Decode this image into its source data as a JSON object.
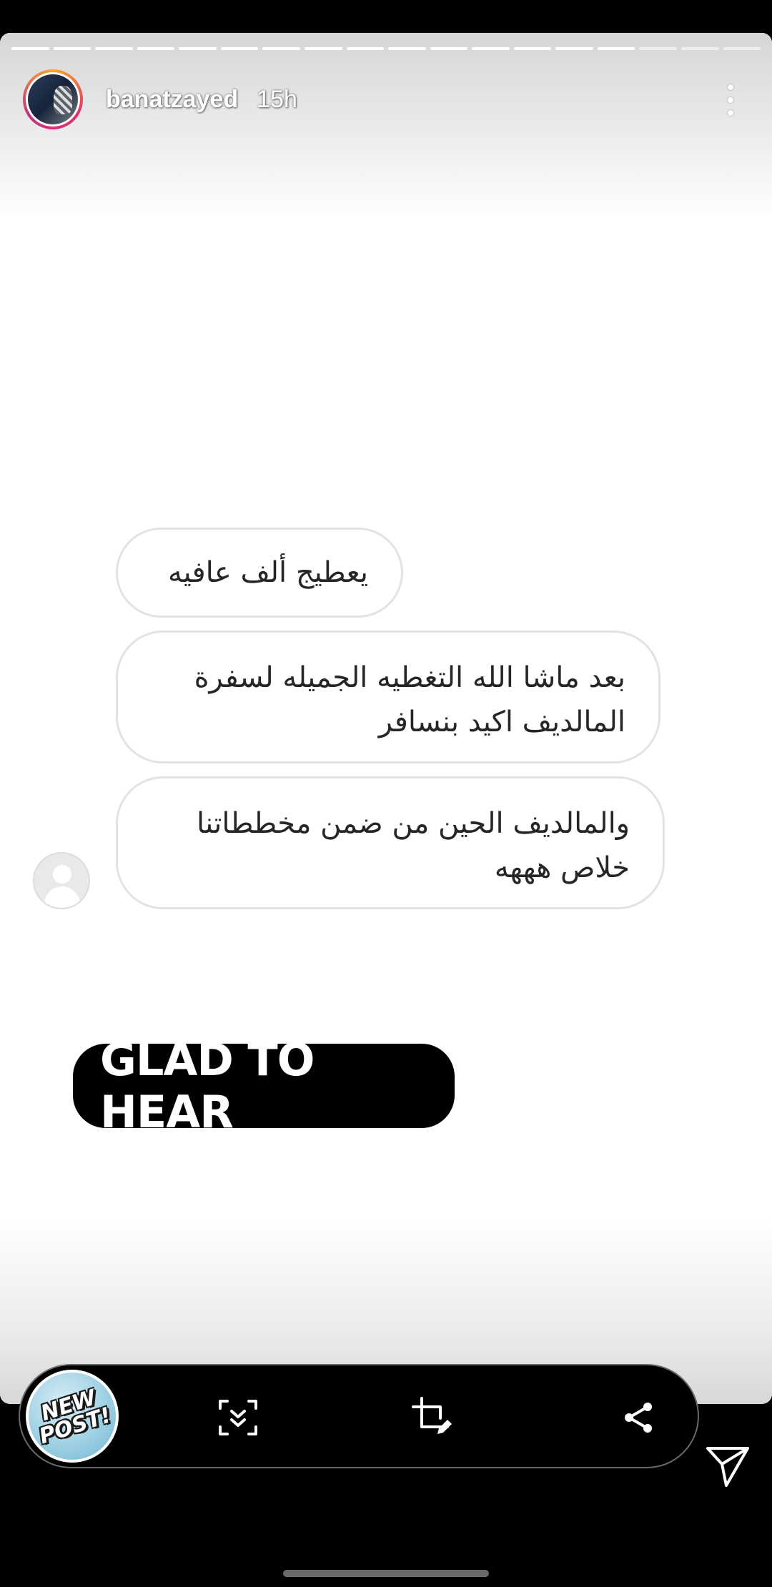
{
  "story": {
    "username": "banatzayed",
    "time": "15h",
    "progress_segments_total": 18,
    "progress_segments_done": 15
  },
  "messages": [
    {
      "text": "يعطيج ألف عافيه"
    },
    {
      "text": "بعد ماشا الله  التغطيه الجميله لسفرة المالديف اكيد بنسافر"
    },
    {
      "text": "والمالديف الحين من ضمن مخططاتنا خلاص هههه"
    }
  ],
  "reply_sticker": {
    "text": "GLAD TO HEAR"
  },
  "action_bar": {
    "new_post_label": "NEW\nPOST!",
    "icons": [
      "scan-down-icon",
      "crop-edit-icon",
      "share-icon"
    ]
  },
  "send_icon": "send-icon",
  "colors": {
    "background": "#000000",
    "card": "#ffffff",
    "bubble_border": "#e3e3e3",
    "sticker": "#000000"
  }
}
